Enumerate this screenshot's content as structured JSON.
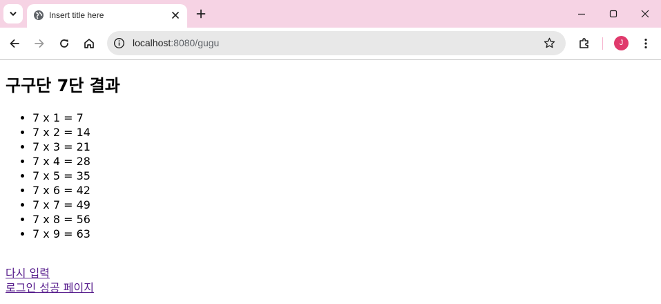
{
  "browser": {
    "tab_title": "Insert title here",
    "address": {
      "host": "localhost",
      "rest": ":8080/gugu"
    },
    "profile_initial": "J",
    "colors": {
      "tabbar": "#f6d3e4",
      "avatar": "#e03a6c",
      "visited_link": "#551a8b"
    },
    "icons": [
      "chevron-down-icon",
      "globe-icon",
      "close-icon",
      "plus-icon",
      "minimize-icon",
      "maximize-icon",
      "back-icon",
      "forward-icon",
      "reload-icon",
      "home-icon",
      "info-icon",
      "star-icon",
      "extensions-icon",
      "more-icon"
    ]
  },
  "page": {
    "title": "구구단 7단 결과",
    "results": [
      "7 x 1 = 7",
      "7 x 2 = 14",
      "7 x 3 = 21",
      "7 x 4 = 28",
      "7 x 5 = 35",
      "7 x 6 = 42",
      "7 x 7 = 49",
      "7 x 8 = 56",
      "7 x 9 = 63"
    ],
    "links": {
      "retry": "다시 입력",
      "login_success": "로그인 성공 페이지"
    }
  }
}
